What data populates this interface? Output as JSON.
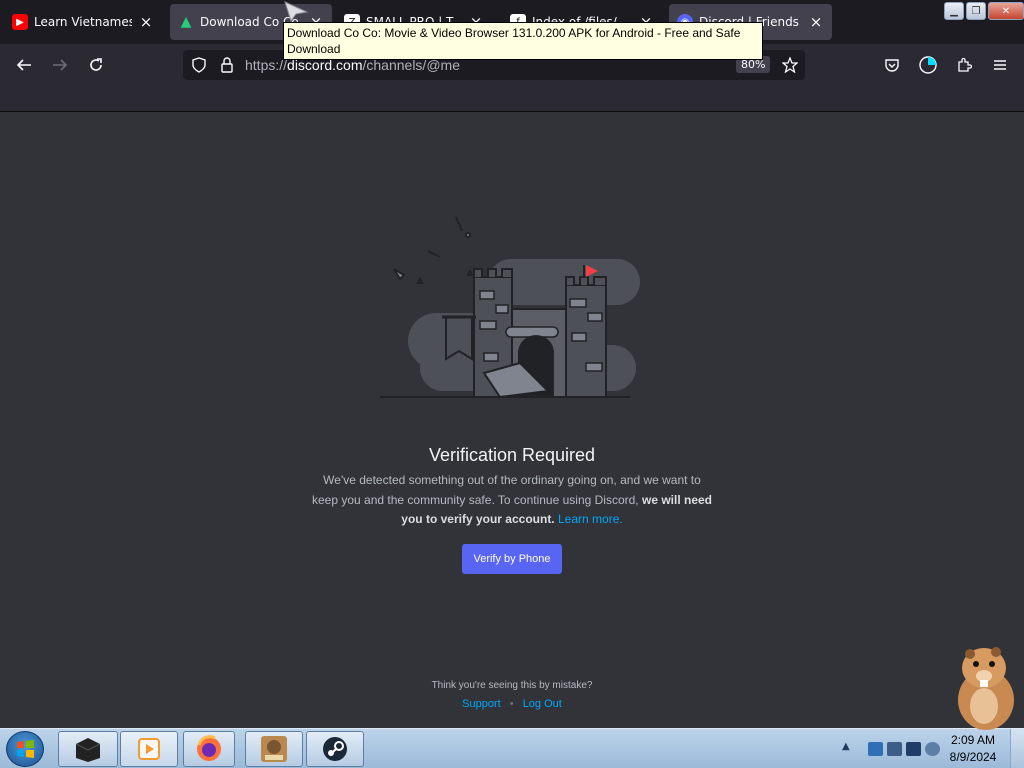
{
  "browser": {
    "tabs": [
      {
        "title": "Learn Vietnamese th",
        "favicon": "youtube-icon",
        "color": "#ff0000"
      },
      {
        "title": "Download Co Co",
        "favicon": "apkpure-icon",
        "color": "#24cd77",
        "active": true
      },
      {
        "title": "SMALL PRO | T",
        "favicon": "z-icon",
        "color": "#111111"
      },
      {
        "title": "Index of /files/",
        "favicon": "f-icon",
        "color": "#111111"
      },
      {
        "title": "Discord | Friends",
        "favicon": "discord-icon",
        "color": "#5865f2"
      }
    ],
    "tooltip": "Download Co Co: Movie & Video Browser 131.0.200 APK for Android - Free and Safe Download",
    "url_prefix": "https://",
    "url_host": "discord.com",
    "url_path": "/channels/@me",
    "zoom": "80%"
  },
  "page": {
    "heading": "Verification Required",
    "desc_1": "We've detected something out of the ordinary going on, and we want to keep you and the community safe. To continue using Discord,",
    "desc_bold": "we will need you to verify your account.",
    "learn_more": "Learn more.",
    "verify_button": "Verify by Phone",
    "mistake_text": "Think you're seeing this by mistake?",
    "support_link": "Support",
    "separator": "•",
    "logout_link": "Log Out"
  },
  "taskbar": {
    "time": "2:09 AM",
    "date": "8/9/2024"
  }
}
